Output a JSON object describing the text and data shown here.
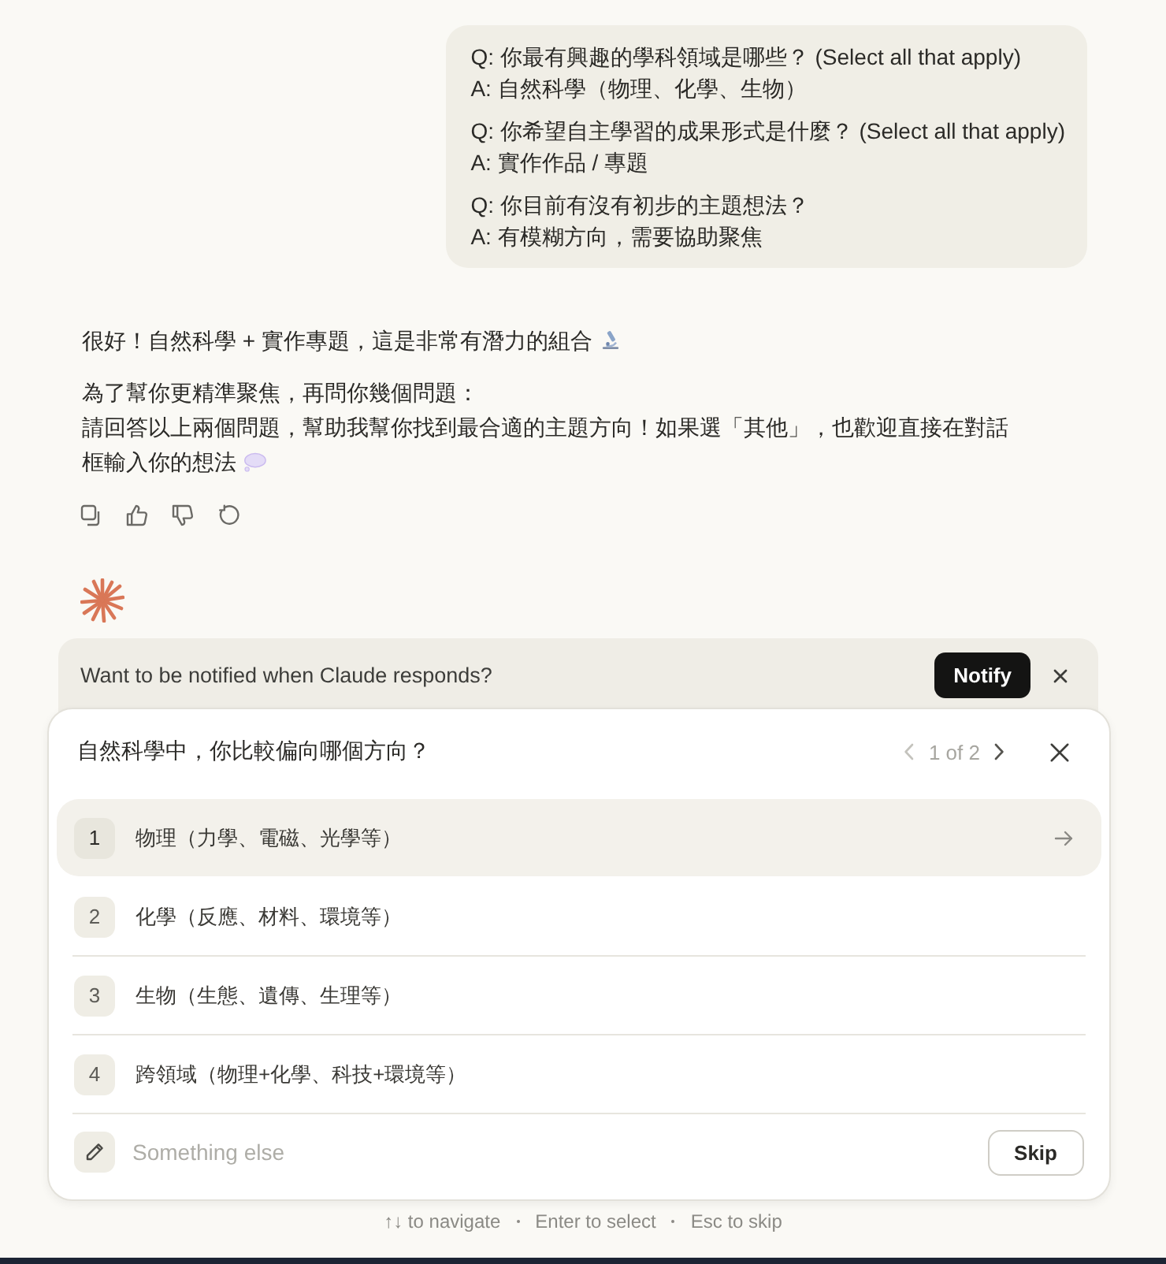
{
  "user_message": {
    "items": [
      {
        "question": "Q: 你最有興趣的學科領域是哪些？ (Select all that apply)",
        "answer": "A: 自然科學（物理、化學、生物）"
      },
      {
        "question": "Q: 你希望自主學習的成果形式是什麼？ (Select all that apply)",
        "answer": "A: 實作作品 / 專題"
      },
      {
        "question": "Q: 你目前有沒有初步的主題想法？",
        "answer": "A: 有模糊方向，需要協助聚焦"
      }
    ]
  },
  "assistant_message": {
    "paragraphs": [
      [
        "很好！自然科學 + 實作專題，這是非常有潛力的組合"
      ],
      [
        "為了幫你更精準聚焦，再問你幾個問題：",
        "請回答以上兩個問題，幫助我幫你找到最合適的主題方向！如果選「其他」，也歡迎直接在對話",
        "框輸入你的想法"
      ]
    ]
  },
  "notification": {
    "message": "Want to be notified when Claude responds?",
    "button": "Notify"
  },
  "question": {
    "title": "自然科學中，你比較偏向哪個方向？",
    "pager": {
      "label": "1 of 2",
      "previous_disabled": true,
      "next_disabled": false
    },
    "options": [
      {
        "number": "1",
        "label": "物理（力學、電磁、光學等）",
        "selected": true
      },
      {
        "number": "2",
        "label": "化學（反應、材料、環境等）",
        "selected": false
      },
      {
        "number": "3",
        "label": "生物（生態、遺傳、生理等）",
        "selected": false
      },
      {
        "number": "4",
        "label": "跨領域（物理+化學、科技+環境等）",
        "selected": false
      }
    ],
    "other": {
      "placeholder": "Something else"
    },
    "skip_button": "Skip"
  },
  "hints": [
    "↑↓ to navigate",
    "Enter to select",
    "Esc to skip"
  ]
}
